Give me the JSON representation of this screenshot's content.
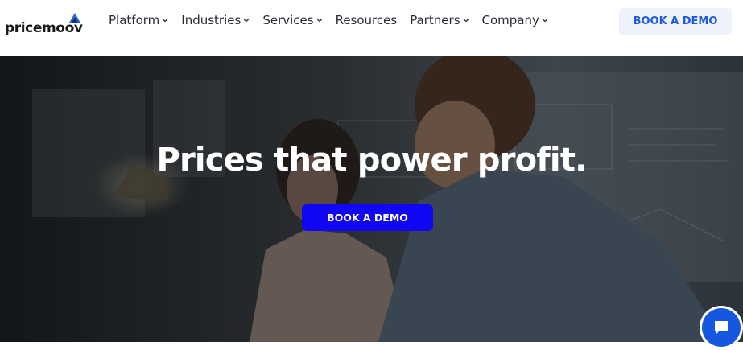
{
  "logo": {
    "text": "pricemoov",
    "icon": "triangle-mark-icon"
  },
  "nav": {
    "items": [
      {
        "label": "Platform",
        "has_dropdown": true
      },
      {
        "label": "Industries",
        "has_dropdown": true
      },
      {
        "label": "Services",
        "has_dropdown": true
      },
      {
        "label": "Resources",
        "has_dropdown": false
      },
      {
        "label": "Partners",
        "has_dropdown": true
      },
      {
        "label": "Company",
        "has_dropdown": true
      }
    ]
  },
  "header": {
    "cta_label": "BOOK A DEMO"
  },
  "hero": {
    "title": "Prices that power profit.",
    "cta_label": "BOOK A DEMO"
  },
  "chat": {
    "icon": "chat-bubble-icon"
  },
  "colors": {
    "primary_cta": "#1106f2",
    "header_cta_bg": "#eef3fb",
    "header_cta_text": "#1f5bd6",
    "chat_button": "#1657e0"
  }
}
